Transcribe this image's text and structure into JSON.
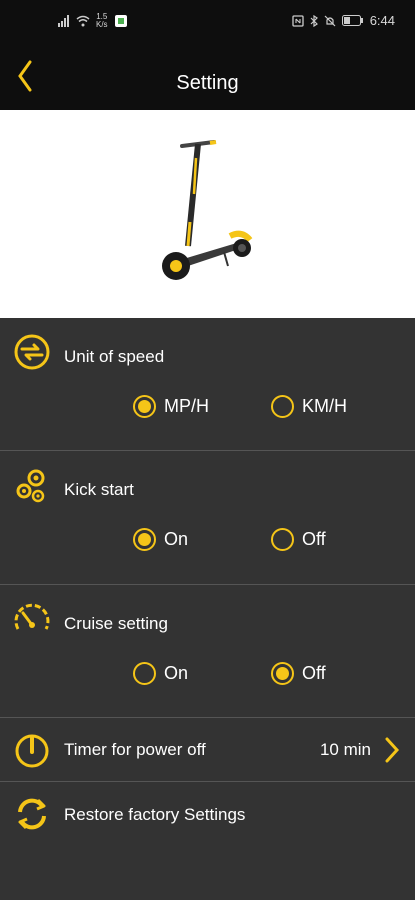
{
  "colors": {
    "accent": "#f5c518",
    "background": "#333333",
    "bar": "#0e0e0e"
  },
  "status_bar": {
    "speed_value": "1.5",
    "speed_unit": "K/s",
    "time": "6:44",
    "icons": [
      "signal-icon",
      "wifi-icon",
      "nfc-icon",
      "bluetooth-icon",
      "mute-icon",
      "battery-icon"
    ]
  },
  "header": {
    "title": "Setting",
    "back_icon": "chevron-left-icon"
  },
  "unit_of_speed": {
    "label": "Unit of speed",
    "options": [
      {
        "label": "MP/H",
        "selected": true
      },
      {
        "label": "KM/H",
        "selected": false
      }
    ]
  },
  "kick_start": {
    "label": "Kick start",
    "options": [
      {
        "label": "On",
        "selected": true
      },
      {
        "label": "Off",
        "selected": false
      }
    ]
  },
  "cruise_setting": {
    "label": "Cruise setting",
    "options": [
      {
        "label": "On",
        "selected": false
      },
      {
        "label": "Off",
        "selected": true
      }
    ]
  },
  "timer": {
    "label": "Timer for power off",
    "value": "10 min"
  },
  "restore": {
    "label": "Restore factory Settings"
  }
}
